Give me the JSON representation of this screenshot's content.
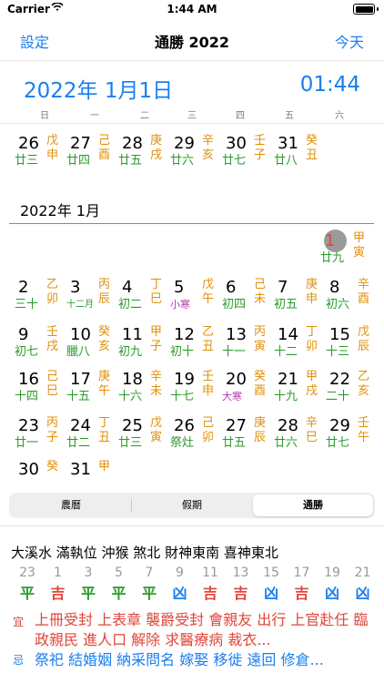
{
  "status": {
    "carrier": "Carrier",
    "time": "1:44 AM"
  },
  "nav": {
    "left": "設定",
    "title": "通勝 2022",
    "right": "今天"
  },
  "header": {
    "date": "2022年 1月1日",
    "time": "01:44"
  },
  "weekdays": [
    "日",
    "一",
    "二",
    "三",
    "四",
    "五",
    "六"
  ],
  "prev_week": [
    {
      "day": "26",
      "lunar": "廿三",
      "gz": "戊申"
    },
    {
      "day": "27",
      "lunar": "廿四",
      "gz": "己酉"
    },
    {
      "day": "28",
      "lunar": "廿五",
      "gz": "庚戌"
    },
    {
      "day": "29",
      "lunar": "廿六",
      "gz": "辛亥"
    },
    {
      "day": "30",
      "lunar": "廿七",
      "gz": "壬子"
    },
    {
      "day": "31",
      "lunar": "廿八",
      "gz": "癸丑"
    }
  ],
  "month_label": "2022年 1月",
  "weeks": [
    [
      {
        "day": "1",
        "lunar": "廿九",
        "gz": "甲寅"
      }
    ],
    [
      {
        "day": "2",
        "lunar": "三十",
        "gz": "乙卯"
      },
      {
        "day": "3",
        "lunar": "十二月",
        "gz": "丙辰"
      },
      {
        "day": "4",
        "lunar": "初二",
        "gz": "丁巳"
      },
      {
        "day": "5",
        "lunar": "小寒",
        "gz": "戊午"
      },
      {
        "day": "6",
        "lunar": "初四",
        "gz": "己未"
      },
      {
        "day": "7",
        "lunar": "初五",
        "gz": "庚申"
      },
      {
        "day": "8",
        "lunar": "初六",
        "gz": "辛酉"
      }
    ],
    [
      {
        "day": "9",
        "lunar": "初七",
        "gz": "壬戌"
      },
      {
        "day": "10",
        "lunar": "臘八",
        "gz": "癸亥"
      },
      {
        "day": "11",
        "lunar": "初九",
        "gz": "甲子"
      },
      {
        "day": "12",
        "lunar": "初十",
        "gz": "乙丑"
      },
      {
        "day": "13",
        "lunar": "十一",
        "gz": "丙寅"
      },
      {
        "day": "14",
        "lunar": "十二",
        "gz": "丁卯"
      },
      {
        "day": "15",
        "lunar": "十三",
        "gz": "戊辰"
      }
    ],
    [
      {
        "day": "16",
        "lunar": "十四",
        "gz": "己巳"
      },
      {
        "day": "17",
        "lunar": "十五",
        "gz": "庚午"
      },
      {
        "day": "18",
        "lunar": "十六",
        "gz": "辛未"
      },
      {
        "day": "19",
        "lunar": "十七",
        "gz": "壬申"
      },
      {
        "day": "20",
        "lunar": "大寒",
        "gz": "癸酉"
      },
      {
        "day": "21",
        "lunar": "十九",
        "gz": "甲戌"
      },
      {
        "day": "22",
        "lunar": "二十",
        "gz": "乙亥"
      }
    ],
    [
      {
        "day": "23",
        "lunar": "廿一",
        "gz": "丙子"
      },
      {
        "day": "24",
        "lunar": "廿二",
        "gz": "丁丑"
      },
      {
        "day": "25",
        "lunar": "廿三",
        "gz": "戊寅"
      },
      {
        "day": "26",
        "lunar": "祭灶",
        "gz": "己卯"
      },
      {
        "day": "27",
        "lunar": "廿五",
        "gz": "庚辰"
      },
      {
        "day": "28",
        "lunar": "廿六",
        "gz": "辛巳"
      },
      {
        "day": "29",
        "lunar": "廿七",
        "gz": "壬午"
      }
    ],
    [
      {
        "day": "30",
        "lunar": "",
        "gz": "癸"
      },
      {
        "day": "31",
        "lunar": "",
        "gz": "甲"
      }
    ]
  ],
  "segments": [
    "農曆",
    "假期",
    "通勝"
  ],
  "tongsheng": "大溪水 滿執位 沖猴 煞北 財神東南 喜神東北",
  "hours": [
    "23",
    "1",
    "3",
    "5",
    "7",
    "9",
    "11",
    "13",
    "15",
    "17",
    "19",
    "21"
  ],
  "luck": [
    "平",
    "吉",
    "平",
    "平",
    "平",
    "凶",
    "吉",
    "吉",
    "凶",
    "吉",
    "凶",
    "凶"
  ],
  "yi_label": "宜",
  "ji_label": "忌",
  "yi": "上冊受封 上表章 襲爵受封 會親友 出行 上官赴任 臨政親民 進人口 解除 求醫療病 裁衣...",
  "ji": "祭祀 結婚姻 納采問名 嫁娶 移徙 遠回 修倉...",
  "colors": {
    "accent": "#1a7ef0",
    "lunar": "#2a9a2a",
    "ganzhi": "#e0900a",
    "sunday": "#e0453a",
    "jieqi": "#b03aaf"
  }
}
